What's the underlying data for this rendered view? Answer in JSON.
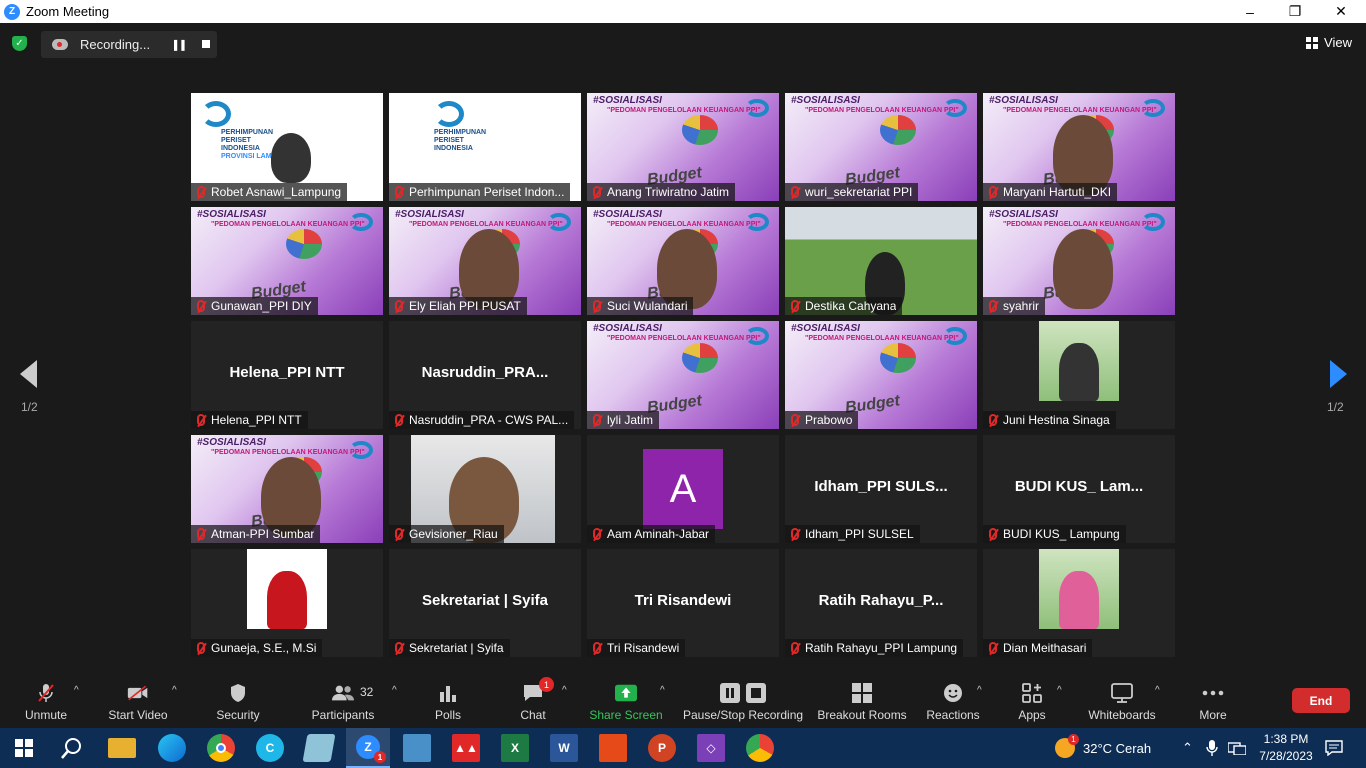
{
  "window": {
    "title": "Zoom Meeting",
    "minimize": "–",
    "restore": "❐",
    "close": "✕"
  },
  "topbar": {
    "recording_label": "Recording...",
    "view_label": "View"
  },
  "pager": {
    "prev_page": "1/2",
    "next_page": "1/2"
  },
  "tiles": [
    {
      "name": "Robet Asnawi_Lampung",
      "kind": "org-logo"
    },
    {
      "name": "Perhimpunan Periset Indon...",
      "kind": "org-logo"
    },
    {
      "name": "Anang Triwiratno Jatim",
      "kind": "slide"
    },
    {
      "name": "wuri_sekretariat PPI",
      "kind": "slide"
    },
    {
      "name": "Maryani Hartuti_DKI",
      "kind": "slide-person"
    },
    {
      "name": "Gunawan_PPI DIY",
      "kind": "slide"
    },
    {
      "name": "Ely Eliah  PPI PUSAT",
      "kind": "slide-person",
      "active": true
    },
    {
      "name": "Suci Wulandari",
      "kind": "slide-person"
    },
    {
      "name": "Destika Cahyana",
      "kind": "field"
    },
    {
      "name": "syahrir",
      "kind": "slide-person"
    },
    {
      "name": "Helena_PPI NTT",
      "kind": "name-only",
      "display": "Helena_PPI NTT"
    },
    {
      "name": "Nasruddin_PRA - CWS PAL...",
      "kind": "name-only",
      "display": "Nasruddin_PRA..."
    },
    {
      "name": "lyli Jatim",
      "kind": "slide"
    },
    {
      "name": "Prabowo",
      "kind": "slide"
    },
    {
      "name": "Juni Hestina Sinaga",
      "kind": "photo"
    },
    {
      "name": "Atman-PPI Sumbar",
      "kind": "slide-person"
    },
    {
      "name": "Gevisioner_Riau",
      "kind": "webcam"
    },
    {
      "name": "Aam Aminah-Jabar",
      "kind": "avatar",
      "initial": "A"
    },
    {
      "name": "Idham_PPI SULSEL",
      "kind": "name-only",
      "display": "Idham_PPI  SULS..."
    },
    {
      "name": "BUDI KUS_ Lampung",
      "kind": "name-only",
      "display": "BUDI KUS_ Lam..."
    },
    {
      "name": "Gunaeja, S.E., M.Si",
      "kind": "photo"
    },
    {
      "name": "Sekretariat | Syifa",
      "kind": "name-only",
      "display": "Sekretariat | Syifa"
    },
    {
      "name": "Tri Risandewi",
      "kind": "name-only",
      "display": "Tri Risandewi"
    },
    {
      "name": "Ratih Rahayu_PPI Lampung",
      "kind": "name-only",
      "display": "Ratih  Rahayu_P..."
    },
    {
      "name": "Dian Meithasari",
      "kind": "photo"
    }
  ],
  "slide": {
    "heading": "#SOSIALISASI",
    "subtitle": "\"PEDOMAN PENGELOLAAN KEUANGAN PPI\"",
    "word": "Budget"
  },
  "logo": {
    "line1": "PERHIMPUNAN",
    "line2": "PERISET",
    "line3": "INDONESIA",
    "line4": "PROVINSI LAMPUNG"
  },
  "toolbar": {
    "unmute": "Unmute",
    "start_video": "Start Video",
    "security": "Security",
    "participants": "Participants",
    "participants_count": "32",
    "polls": "Polls",
    "chat": "Chat",
    "chat_badge": "1",
    "share_screen": "Share Screen",
    "pause_stop": "Pause/Stop Recording",
    "breakout": "Breakout Rooms",
    "reactions": "Reactions",
    "apps": "Apps",
    "whiteboards": "Whiteboards",
    "more": "More",
    "end": "End"
  },
  "taskbar": {
    "weather": "32°C  Cerah",
    "time": "1:38 PM",
    "date": "7/28/2023",
    "zoom_badge": "1",
    "weather_badge": "1"
  },
  "colors": {
    "accent": "#2d8cff",
    "end": "#d22c2c",
    "share": "#23b14d",
    "mute": "#e02828",
    "active_speaker": "#f0e37a"
  }
}
